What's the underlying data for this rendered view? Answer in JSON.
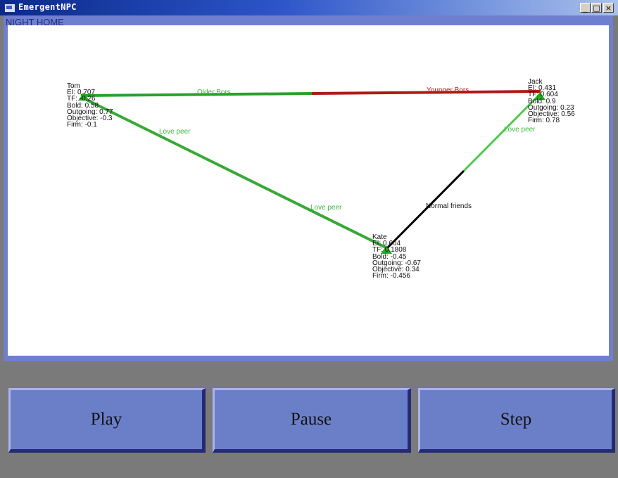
{
  "window": {
    "title": "EmergentNPC",
    "minimize_glyph": "_",
    "maximize_glyph": "□",
    "close_glyph": "×"
  },
  "scene": {
    "label": "NIGHT HOME"
  },
  "nodes": {
    "tom": {
      "lines": [
        "Tom",
        "EI: 0.707",
        "TF: -0.26",
        "Bold: 0.58",
        "Outgoing: 0.77",
        "Objective: -0.3",
        "Firm: -0.1"
      ]
    },
    "jack": {
      "lines": [
        "Jack",
        "EI: 0.431",
        "TF: 0.604",
        "Bold: 0.9",
        "Outgoing: 0.23",
        "Objective: 0.56",
        "Firm: 0.78"
      ]
    },
    "kate": {
      "lines": [
        "Kate",
        "EI: 0.604",
        "TF: 0.1808",
        "Bold: -0.45",
        "Outgoing: -0.67",
        "Objective: 0.34",
        "Firm: -0.456"
      ]
    }
  },
  "relations": {
    "tom_jack_older": "Older Bors",
    "tom_jack_younger": "Younger Bors",
    "tom_kate_a": "Love peer",
    "tom_kate_b": "Love peer",
    "jack_kate_love": "Love peer",
    "jack_kate_friends": "Normal friends"
  },
  "colors": {
    "older_bors": "#2aa02a",
    "younger_bors": "#b01818",
    "love_peer": "#3cb83c",
    "normal_friends": "#000000"
  },
  "controls": {
    "play_label": "Play",
    "pause_label": "Pause",
    "step_label": "Step"
  }
}
